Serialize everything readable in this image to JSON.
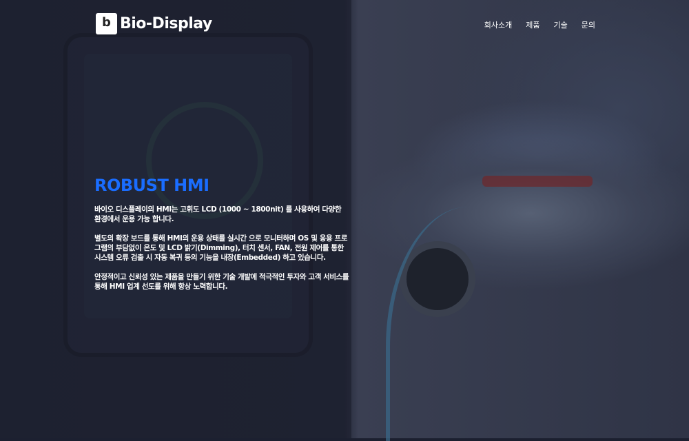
{
  "header": {
    "logo_text": "Bio-Display",
    "nav": [
      "회사소개",
      "제품",
      "기술",
      "문의"
    ]
  },
  "main": {
    "title": "ROBUST HMI",
    "paragraphs": [
      "바이오 디스플레이의 HMI는 고휘도 LCD (1000 ~ 1800nit) 를 사용하여 다양한 환경에서 운용 가능 합니다.",
      "별도의 확장 보드를 통해 HMI의 운용 상태를 실시간 으로 모니터하며 OS 및 응용 프로그램의 부담없이 온도 및 LCD 밝기(Dimming), 터치 센서, FAN, 전원 제어를 통한 시스템 오류 검출 시 자동 복귀 등의 기능을 내장(Embedded) 하고 있습니다.",
      "안정적이고 신뢰성 있는 제품을 만들기 위한 기술 개발에 적극적인 투자와 고객 서비스를 통해 HMI 업계 선도를 위해 항상 노력합니다."
    ]
  },
  "colors": {
    "accent": "#1a6dff"
  }
}
